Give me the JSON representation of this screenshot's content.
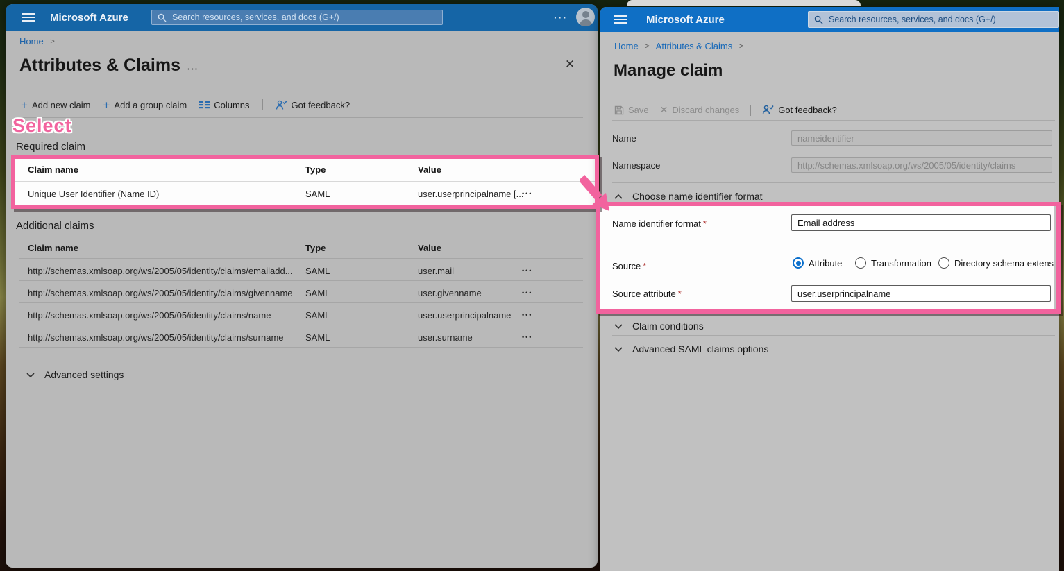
{
  "icons": {
    "plus": "+",
    "more_horizontal": "···",
    "ellipsis_menu": "•••",
    "close": "✕",
    "breadcrumb_chevron": ">"
  },
  "annotations": {
    "select_label": "Select"
  },
  "colors": {
    "azure_blue": "#0f6fc5",
    "highlight_pink": "#f2639e",
    "selected_radio_blue": "#0c70cc"
  },
  "left_window": {
    "topbar": {
      "brand": "Microsoft Azure",
      "search_placeholder": "Search resources, services, and docs (G+/)"
    },
    "breadcrumb": {
      "home": "Home"
    },
    "title": "Attributes & Claims",
    "toolbar": {
      "add_new_claim": "Add new claim",
      "add_group_claim": "Add a group claim",
      "columns": "Columns",
      "got_feedback": "Got feedback?"
    },
    "required_claim": {
      "heading": "Required claim",
      "columns": {
        "claim_name": "Claim name",
        "type": "Type",
        "value": "Value"
      },
      "row": {
        "claim_name": "Unique User Identifier (Name ID)",
        "type": "SAML",
        "value": "user.userprincipalname [..."
      }
    },
    "additional_claims": {
      "heading": "Additional claims",
      "columns": {
        "claim_name": "Claim name",
        "type": "Type",
        "value": "Value"
      },
      "rows": [
        {
          "claim_name": "http://schemas.xmlsoap.org/ws/2005/05/identity/claims/emailadd...",
          "type": "SAML",
          "value": "user.mail"
        },
        {
          "claim_name": "http://schemas.xmlsoap.org/ws/2005/05/identity/claims/givenname",
          "type": "SAML",
          "value": "user.givenname"
        },
        {
          "claim_name": "http://schemas.xmlsoap.org/ws/2005/05/identity/claims/name",
          "type": "SAML",
          "value": "user.userprincipalname"
        },
        {
          "claim_name": "http://schemas.xmlsoap.org/ws/2005/05/identity/claims/surname",
          "type": "SAML",
          "value": "user.surname"
        }
      ]
    },
    "advanced_settings": "Advanced settings"
  },
  "right_window": {
    "topbar": {
      "brand": "Microsoft Azure",
      "search_placeholder": "Search resources, services, and docs (G+/)"
    },
    "breadcrumb": {
      "home": "Home",
      "parent": "Attributes & Claims"
    },
    "title": "Manage claim",
    "toolbar": {
      "save": "Save",
      "discard": "Discard changes",
      "got_feedback": "Got feedback?"
    },
    "form": {
      "name": {
        "label": "Name",
        "value": "nameidentifier"
      },
      "namespace": {
        "label": "Namespace",
        "value": "http://schemas.xmlsoap.org/ws/2005/05/identity/claims"
      },
      "choose_format_section": "Choose name identifier format",
      "name_identifier_format": {
        "label": "Name identifier format",
        "value": "Email address"
      },
      "source": {
        "label": "Source",
        "options": [
          "Attribute",
          "Transformation",
          "Directory schema extension"
        ],
        "selected": "Attribute"
      },
      "source_attribute": {
        "label": "Source attribute",
        "value": "user.userprincipalname"
      },
      "claim_conditions_section": "Claim conditions",
      "advanced_saml_section": "Advanced SAML claims options"
    }
  }
}
